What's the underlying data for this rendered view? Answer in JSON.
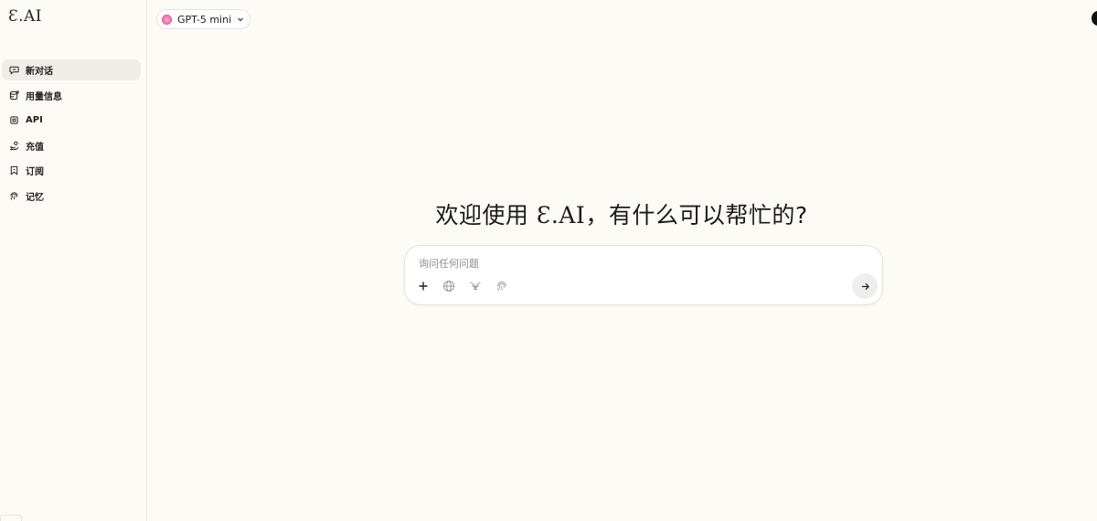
{
  "app": {
    "logo": "Ɛ.AI"
  },
  "sidebar": {
    "items": [
      {
        "label": "新对话",
        "icon": "chat-bubble-icon"
      },
      {
        "label": "用量信息",
        "icon": "database-icon"
      },
      {
        "label": "API",
        "icon": "chip-icon"
      },
      {
        "label": "充值",
        "icon": "hand-coin-icon"
      },
      {
        "label": "订阅",
        "icon": "bookmark-icon"
      },
      {
        "label": "记忆",
        "icon": "fingerprint-icon"
      }
    ]
  },
  "model_selector": {
    "label": "GPT-5 mini",
    "icon": "model-dot-icon",
    "color": "#ee6aa6"
  },
  "main": {
    "headline_prefix": "欢迎使用 ",
    "headline_brand": "Ɛ.AI",
    "headline_suffix": "，有什么可以帮忙的?"
  },
  "composer": {
    "placeholder": "询问任何问题",
    "value": "",
    "tools": [
      "plus-icon",
      "globe-icon",
      "wing-icon",
      "fingerprint-icon"
    ],
    "send_icon": "arrow-right-icon"
  },
  "colors": {
    "background": "#fcfbf6",
    "active_nav": "#efede7",
    "border": "#e4e2dc"
  }
}
